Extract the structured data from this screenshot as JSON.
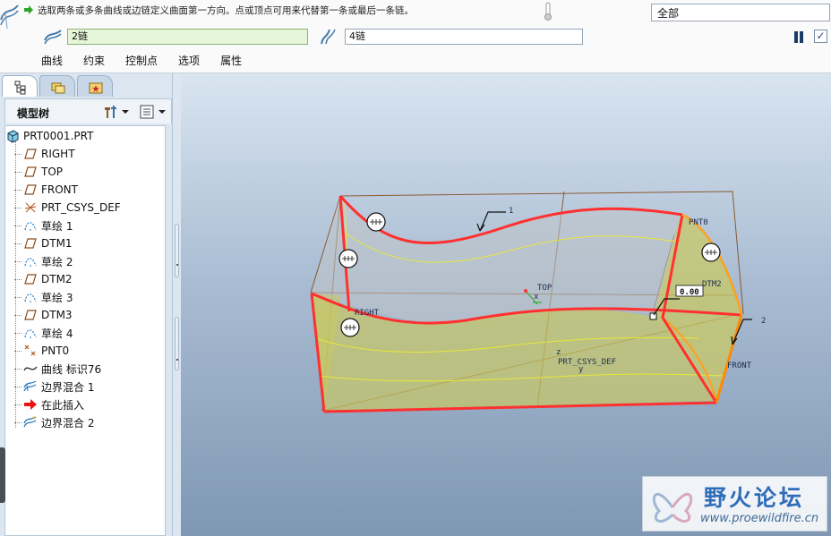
{
  "dashboard": {
    "message": "选取两条或多条曲线或边链定义曲面第一方向。点或顶点可用来代替第一条或最后一条链。",
    "filter_value": "全部",
    "first_collector": "2链",
    "second_collector": "4链",
    "tabs": [
      "曲线",
      "约束",
      "控制点",
      "选项",
      "属性"
    ],
    "icons": [
      "boundary-blend-icon",
      "first-direction-icon",
      "second-direction-icon",
      "pause-icon",
      "ok-checkmark-icon"
    ]
  },
  "navigator": {
    "tree_title": "模型树",
    "items": [
      {
        "label": "PRT0001.PRT",
        "icon": "part-icon"
      },
      {
        "label": "RIGHT",
        "icon": "datum-plane-icon"
      },
      {
        "label": "TOP",
        "icon": "datum-plane-icon"
      },
      {
        "label": "FRONT",
        "icon": "datum-plane-icon"
      },
      {
        "label": "PRT_CSYS_DEF",
        "icon": "csys-icon"
      },
      {
        "label": "草绘 1",
        "icon": "sketch-icon"
      },
      {
        "label": "DTM1",
        "icon": "datum-plane-icon"
      },
      {
        "label": "草绘 2",
        "icon": "sketch-icon"
      },
      {
        "label": "DTM2",
        "icon": "datum-plane-icon"
      },
      {
        "label": "草绘 3",
        "icon": "sketch-icon"
      },
      {
        "label": "DTM3",
        "icon": "datum-plane-icon"
      },
      {
        "label": "草绘 4",
        "icon": "sketch-icon"
      },
      {
        "label": "PNT0",
        "icon": "datum-point-icon"
      },
      {
        "label": "曲线 标识76",
        "icon": "curve-icon"
      },
      {
        "label": "边界混合 1",
        "icon": "boundary-blend-icon"
      },
      {
        "label": "在此插入",
        "icon": "insert-here-arrow-icon"
      },
      {
        "label": "边界混合 2",
        "icon": "boundary-blend-new-icon"
      }
    ]
  },
  "graphics": {
    "labels": {
      "chain1": "1",
      "chain2": "2",
      "pnt0": "PNT0",
      "dtm2": "DTM2",
      "top": "TOP",
      "right": "RIGHT",
      "front": "FRONT",
      "csys": "PRT_CSYS_DEF",
      "dim": "0.00",
      "x": "x",
      "y": "y",
      "z": "z"
    }
  },
  "watermark": {
    "text": "野火论坛",
    "url": "www.proewildfire.cn"
  },
  "colors": {
    "chain_highlight": "#ff3030",
    "surface_yellow": "#c8c864",
    "datum_brown": "#8a5a32",
    "background_top": "#d9e5f1",
    "background_bottom": "#7f97b4"
  }
}
